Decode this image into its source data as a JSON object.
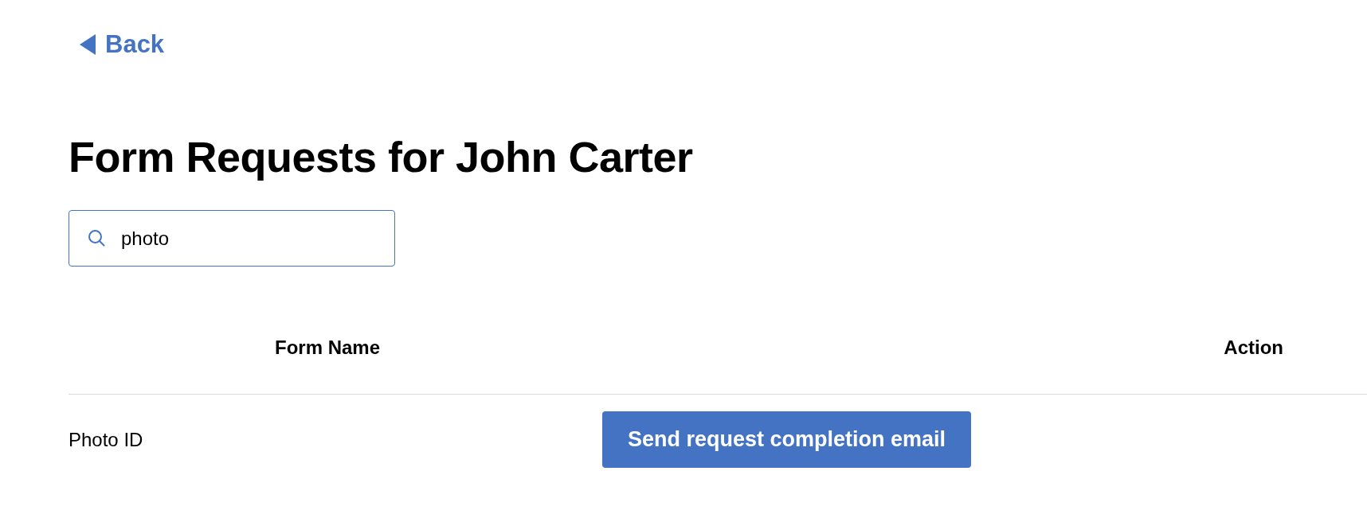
{
  "back_link": {
    "label": "Back"
  },
  "title": "Form Requests for John Carter",
  "search": {
    "value": "photo"
  },
  "table": {
    "columns": [
      "Form Name",
      "Action"
    ],
    "rows": [
      {
        "form_name": "Photo ID",
        "action": "Send request completion email"
      }
    ]
  }
}
